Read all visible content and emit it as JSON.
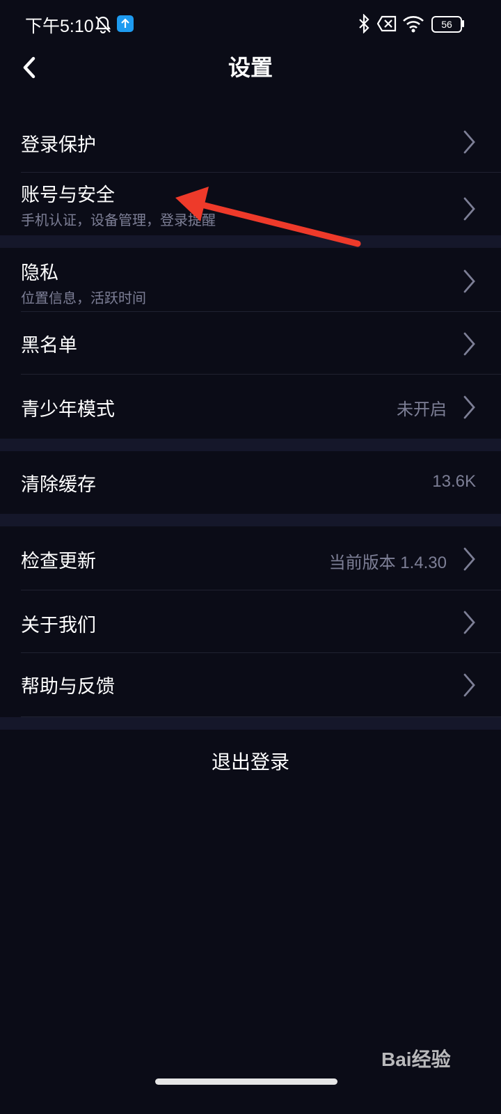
{
  "status_bar": {
    "time": "下午5:10",
    "battery": "56",
    "icons": [
      "bell-off-icon",
      "upload-notification-icon",
      "bluetooth-icon",
      "no-sim-icon",
      "wifi-icon",
      "battery-icon"
    ]
  },
  "header": {
    "title": "设置",
    "back_icon": "chevron-left-icon"
  },
  "settings": {
    "login_protection": {
      "title": "登录保护"
    },
    "account_security": {
      "title": "账号与安全",
      "subtitle": "手机认证，设备管理，登录提醒"
    },
    "privacy": {
      "title": "隐私",
      "subtitle": "位置信息，活跃时间"
    },
    "blacklist": {
      "title": "黑名单"
    },
    "teen_mode": {
      "title": "青少年模式",
      "value": "未开启"
    },
    "clear_cache": {
      "title": "清除缓存",
      "value": "13.6K"
    },
    "check_update": {
      "title": "检查更新",
      "value": "当前版本 1.4.30"
    },
    "about_us": {
      "title": "关于我们"
    },
    "help_feedback": {
      "title": "帮助与反馈"
    }
  },
  "logout": {
    "label": "退出登录"
  },
  "watermark": {
    "text": "Bai经验"
  },
  "colors": {
    "background": "#0b0c17",
    "section_gap": "#15172a",
    "secondary_text": "#7d7f96",
    "annotation_arrow": "#ee3a2a",
    "notification_badge": "#1e9bf0"
  }
}
